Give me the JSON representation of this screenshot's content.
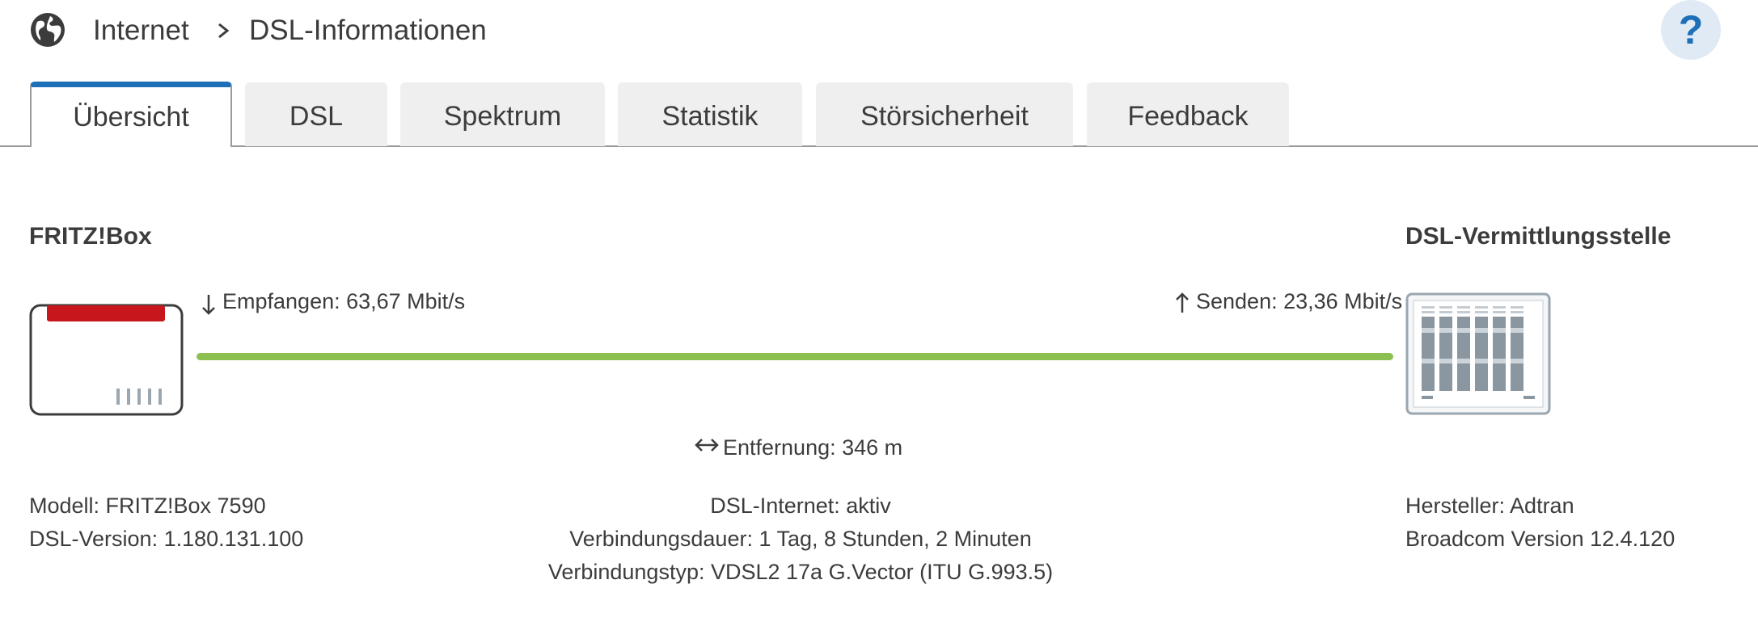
{
  "breadcrumb": {
    "icon": "globe-icon",
    "items": [
      "Internet",
      "DSL-Informationen"
    ]
  },
  "help": {
    "label": "?",
    "icon": "help-icon"
  },
  "tabs": [
    {
      "label": "Übersicht",
      "active": true
    },
    {
      "label": "DSL",
      "active": false
    },
    {
      "label": "Spektrum",
      "active": false
    },
    {
      "label": "Statistik",
      "active": false
    },
    {
      "label": "Störsicherheit",
      "active": false
    },
    {
      "label": "Feedback",
      "active": false
    }
  ],
  "overview": {
    "left_title": "FRITZ!Box",
    "right_title": "DSL-Vermittlungsstelle",
    "receive": "Empfangen: 63,67 Mbit/s",
    "send": "Senden: 23,36 Mbit/s",
    "distance": "Entfernung: 346 m",
    "device_info": [
      "Modell: FRITZ!Box 7590",
      "DSL-Version: 1.180.131.100"
    ],
    "connection_info": [
      "DSL-Internet: aktiv",
      "Verbindungsdauer: 1 Tag, 8 Stunden, 2 Minuten",
      "Verbindungstyp: VDSL2 17a G.Vector (ITU G.993.5)"
    ],
    "exchange_info": [
      "Hersteller: Adtran",
      "Broadcom Version 12.4.120"
    ]
  },
  "colors": {
    "accent": "#1d6fb8",
    "link_active": "#8cc152",
    "router_red": "#c8161d"
  }
}
